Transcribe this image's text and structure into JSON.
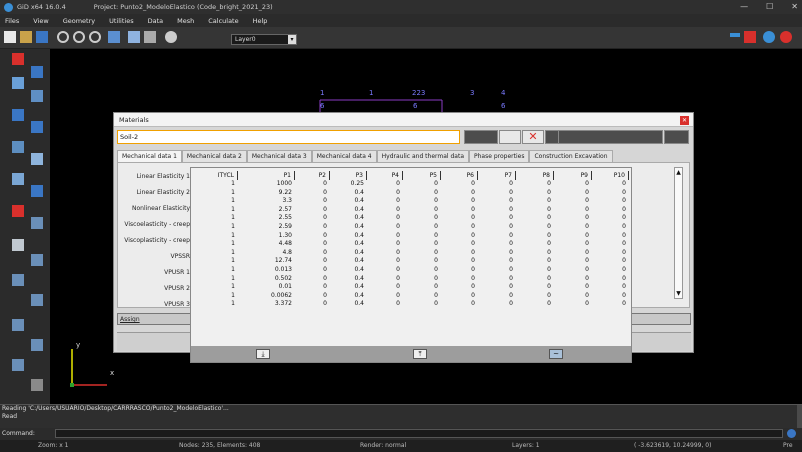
{
  "window": {
    "app_title": "GiD x64 16.0.4",
    "project_title": "Project: Punto2_ModeloElastico (Code_bright_2021_23)",
    "controls": [
      "—",
      "☐",
      "✕"
    ]
  },
  "menu": [
    "Files",
    "View",
    "Geometry",
    "Utilities",
    "Data",
    "Mesh",
    "Calculate",
    "Help"
  ],
  "toolbar": {
    "layer_value": "Layer0"
  },
  "canvas": {
    "labels": [
      "1",
      "1",
      "223",
      "3",
      "4",
      "6",
      "6",
      "6"
    ],
    "axis_y": "y",
    "axis_x": "x"
  },
  "console": {
    "line1": "Reading 'C:/Users/USUARIO/Desktop/CARRRASCO/Punto2_ModeloElastico'...",
    "line2": "Read"
  },
  "command": {
    "label": "Command:"
  },
  "status": {
    "zoom": "Zoom: x 1",
    "nodes": "Nodes: 235, Elements: 408",
    "render": "Render: normal",
    "layers": "Layers: 1",
    "coords": "( -3.623619,  10.24999, 0)",
    "pre": "Pre"
  },
  "materials": {
    "title": "Materials",
    "selected": "Soil-2",
    "tabs": [
      "Mechanical data 1",
      "Mechanical data 2",
      "Mechanical data 3",
      "Mechanical data 4",
      "Hydraulic and thermal data",
      "Phase properties",
      "Construction Excavation"
    ],
    "left_items": [
      "Linear Elasticity 1",
      "Linear Elasticity 2",
      "Nonlinear Elasticity",
      "Viscoelasticity - creep",
      "Viscoplasticity - creep",
      "VPSSR",
      "VPUSR 1",
      "VPUSR 2",
      "VPUSR 3"
    ],
    "assign_label": "Assign"
  },
  "table": {
    "headers": [
      "ITYCL",
      "P1",
      "P2",
      "P3",
      "P4",
      "P5",
      "P6",
      "P7",
      "P8",
      "P9",
      "P10"
    ],
    "rows": [
      [
        "1",
        "1000",
        "0",
        "0.25",
        "0",
        "0",
        "0",
        "0",
        "0",
        "0",
        "0"
      ],
      [
        "1",
        "9.22",
        "0",
        "0.4",
        "0",
        "0",
        "0",
        "0",
        "0",
        "0",
        "0"
      ],
      [
        "1",
        "3.3",
        "0",
        "0.4",
        "0",
        "0",
        "0",
        "0",
        "0",
        "0",
        "0"
      ],
      [
        "1",
        "2.57",
        "0",
        "0.4",
        "0",
        "0",
        "0",
        "0",
        "0",
        "0",
        "0"
      ],
      [
        "1",
        "2.55",
        "0",
        "0.4",
        "0",
        "0",
        "0",
        "0",
        "0",
        "0",
        "0"
      ],
      [
        "1",
        "2.59",
        "0",
        "0.4",
        "0",
        "0",
        "0",
        "0",
        "0",
        "0",
        "0"
      ],
      [
        "1",
        "1.30",
        "0",
        "0.4",
        "0",
        "0",
        "0",
        "0",
        "0",
        "0",
        "0"
      ],
      [
        "1",
        "4.48",
        "0",
        "0.4",
        "0",
        "0",
        "0",
        "0",
        "0",
        "0",
        "0"
      ],
      [
        "1",
        "4.8",
        "0",
        "0.4",
        "0",
        "0",
        "0",
        "0",
        "0",
        "0",
        "0"
      ],
      [
        "1",
        "12.74",
        "0",
        "0.4",
        "0",
        "0",
        "0",
        "0",
        "0",
        "0",
        "0"
      ],
      [
        "1",
        "0.013",
        "0",
        "0.4",
        "0",
        "0",
        "0",
        "0",
        "0",
        "0",
        "0"
      ],
      [
        "1",
        "0.502",
        "0",
        "0.4",
        "0",
        "0",
        "0",
        "0",
        "0",
        "0",
        "0"
      ],
      [
        "1",
        "0.01",
        "0",
        "0.4",
        "0",
        "0",
        "0",
        "0",
        "0",
        "0",
        "0"
      ],
      [
        "1",
        "0.0062",
        "0",
        "0.4",
        "0",
        "0",
        "0",
        "0",
        "0",
        "0",
        "0"
      ],
      [
        "1",
        "3.372",
        "0",
        "0.4",
        "0",
        "0",
        "0",
        "0",
        "0",
        "0",
        "0"
      ]
    ]
  },
  "colors": {
    "accent_orange": "#f0a000",
    "close_red": "#d9302c",
    "canvas_bg": "#000000"
  }
}
